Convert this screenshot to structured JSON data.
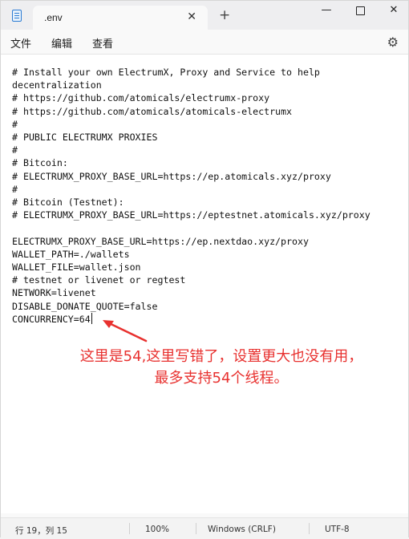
{
  "tab": {
    "title": ".env",
    "close": "✕",
    "new_tab": "+"
  },
  "window_controls": {
    "minimize": "—",
    "close": "✕"
  },
  "menu": {
    "file": "文件",
    "edit": "编辑",
    "view": "查看",
    "settings_icon": "⚙"
  },
  "editor": {
    "lines": [
      "# Install your own ElectrumX, Proxy and Service to help decentralization",
      "# https://github.com/atomicals/electrumx-proxy",
      "# https://github.com/atomicals/atomicals-electrumx",
      "#",
      "# PUBLIC ELECTRUMX PROXIES",
      "#",
      "# Bitcoin:",
      "# ELECTRUMX_PROXY_BASE_URL=https://ep.atomicals.xyz/proxy",
      "#",
      "# Bitcoin (Testnet):",
      "# ELECTRUMX_PROXY_BASE_URL=https://eptestnet.atomicals.xyz/proxy",
      "",
      "ELECTRUMX_PROXY_BASE_URL=https://ep.nextdao.xyz/proxy",
      "WALLET_PATH=./wallets",
      "WALLET_FILE=wallet.json",
      "# testnet or livenet or regtest",
      "NETWORK=livenet",
      "DISABLE_DONATE_QUOTE=false",
      "CONCURRENCY=64"
    ]
  },
  "annotation": {
    "line1": "这里是54,这里写错了，设置更大也没有用，",
    "line2": "最多支持54个线程。",
    "color": "#e8312f"
  },
  "status": {
    "position": "行 19，列 15",
    "zoom": "100%",
    "line_ending": "Windows (CRLF)",
    "encoding": "UTF-8"
  }
}
